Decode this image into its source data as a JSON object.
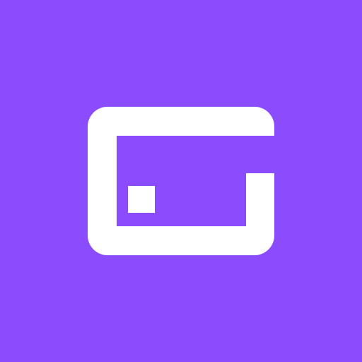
{
  "colors": {
    "background": "#8b4cfd",
    "mark": "#ffffff"
  },
  "icon": {
    "name": "card-wallet-logo-icon"
  }
}
